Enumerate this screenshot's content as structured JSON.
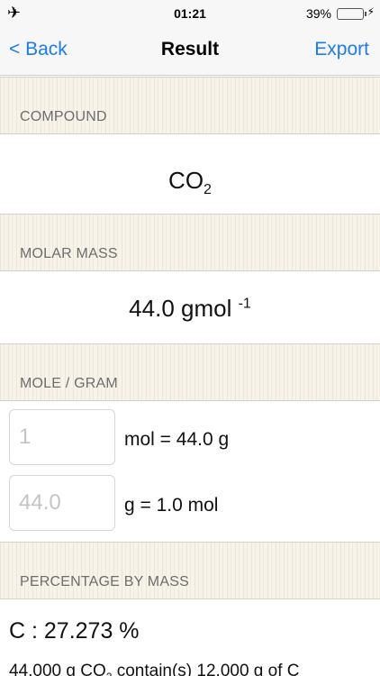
{
  "status_bar": {
    "airplane_icon": "airplane-icon",
    "time": "01:21",
    "battery_percent": "39%",
    "battery_level": 0.39,
    "battery_color": "#4cd964"
  },
  "nav": {
    "back_label": "< Back",
    "title": "Result",
    "export_label": "Export",
    "accent_color": "#1a7cf5"
  },
  "sections": {
    "compound": {
      "header": "COMPOUND",
      "formula_main": "CO",
      "formula_sub": "2"
    },
    "molar_mass": {
      "header": "MOLAR MASS",
      "value": "44.0 gmol",
      "exponent": "-1"
    },
    "mole_gram": {
      "header": "MOLE / GRAM",
      "mol_placeholder": "1",
      "mol_result": "mol = 44.0 g",
      "gram_placeholder": "44.0",
      "gram_result": "g = 1.0 mol"
    },
    "percentage": {
      "header": "PERCENTAGE BY MASS",
      "element_line": "C : 27.273 %",
      "detail_prefix": "44.000 g CO",
      "detail_sub": "2",
      "detail_suffix": " contain(s) 12.000 g of C"
    }
  }
}
